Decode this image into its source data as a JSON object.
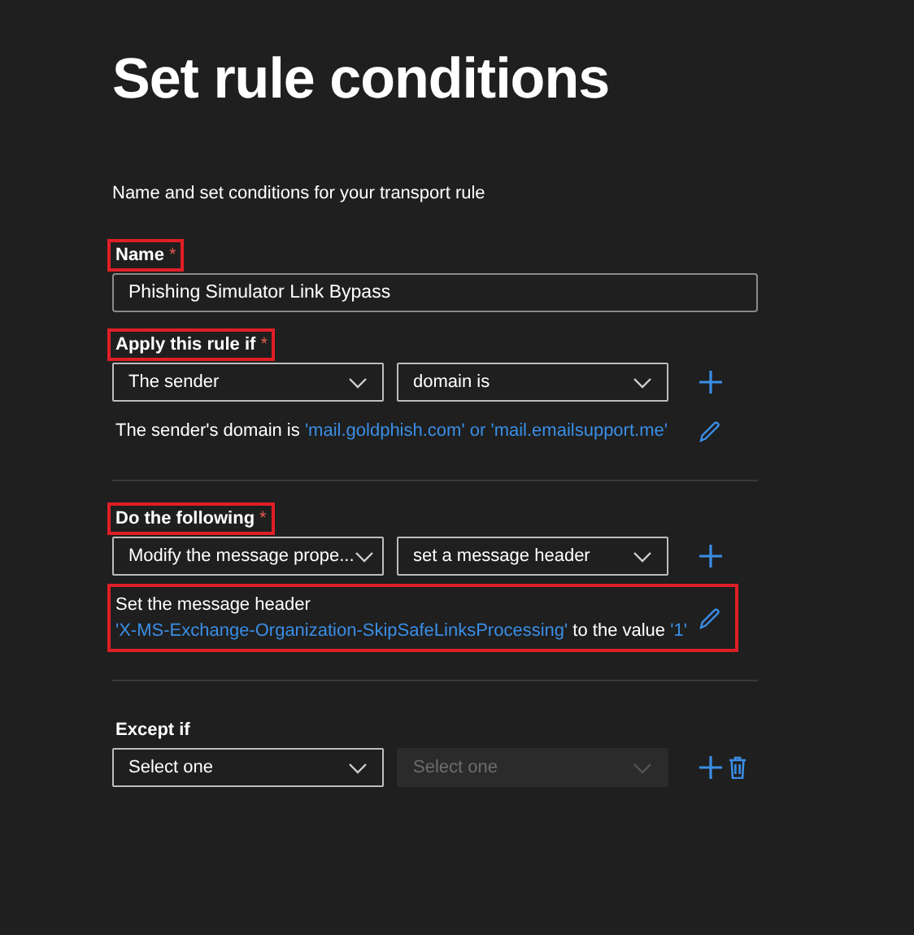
{
  "title": "Set rule conditions",
  "subtitle": "Name and set conditions for your transport rule",
  "name_field": {
    "label": "Name",
    "required_mark": "*",
    "highlighted": true,
    "value": "Phishing Simulator Link Bypass"
  },
  "sections": [
    {
      "label": "Apply this rule if",
      "required_mark": "*",
      "highlighted": true,
      "deletable": false,
      "selects": [
        {
          "value": "The sender",
          "disabled": false
        },
        {
          "value": "domain is",
          "disabled": false
        }
      ],
      "summary": {
        "highlighted": false,
        "lines": [
          [
            {
              "kind": "plain",
              "text": "The sender's domain is"
            },
            {
              "kind": "value",
              "text": "'mail.goldphish.com'"
            },
            {
              "kind": "value",
              "text": "or"
            },
            {
              "kind": "value",
              "text": "'mail.emailsupport.me'"
            }
          ]
        ]
      }
    },
    {
      "label": "Do the following",
      "required_mark": "*",
      "highlighted": true,
      "deletable": false,
      "selects": [
        {
          "value": "Modify the message prope...",
          "disabled": false
        },
        {
          "value": "set a message header",
          "disabled": false
        }
      ],
      "summary": {
        "highlighted": true,
        "lines": [
          [
            {
              "kind": "plain",
              "text": "Set the message header"
            }
          ],
          [
            {
              "kind": "value",
              "text": "'X-MS-Exchange-Organization-SkipSafeLinksProcessing'"
            },
            {
              "kind": "plain",
              "text": "to the value"
            },
            {
              "kind": "value",
              "text": "'1'"
            }
          ]
        ]
      }
    },
    {
      "label": "Except if",
      "highlighted": false,
      "deletable": true,
      "selects": [
        {
          "value": "Select one",
          "disabled": false
        },
        {
          "value": "Select one",
          "disabled": true
        }
      ]
    }
  ]
}
